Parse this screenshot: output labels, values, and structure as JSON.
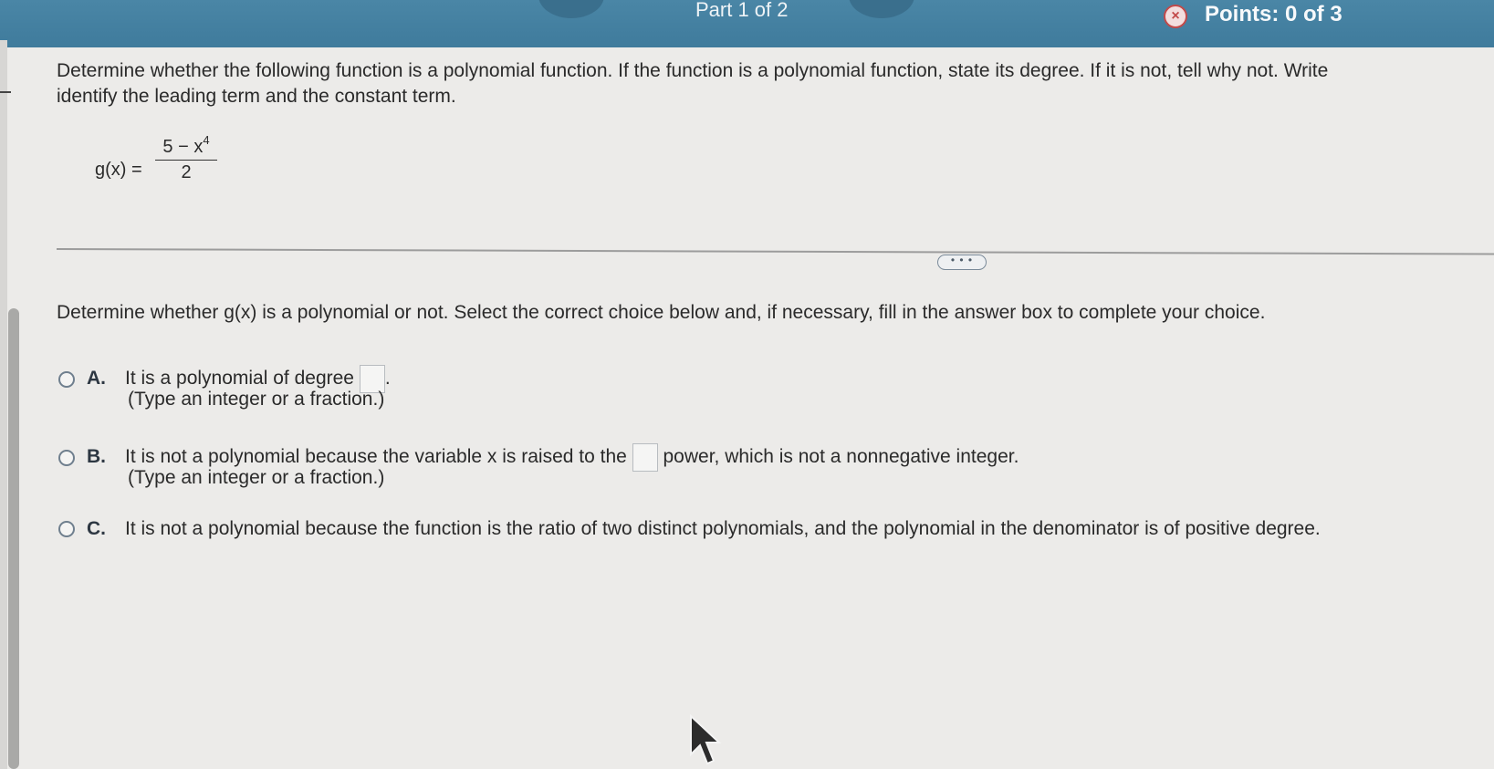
{
  "header": {
    "part_label": "Part 1 of 2",
    "points_label": "Points: 0 of 3",
    "status_icon_glyph": "×",
    "colors": {
      "bar": "#4481a1",
      "error": "#c24a4a"
    }
  },
  "question": {
    "prompt_line1": "Determine whether the following function is a polynomial function. If the function is a polynomial function, state its degree. If it is not, tell why not. Write",
    "prompt_line2": "identify the leading term and the constant term.",
    "function_lhs": "g(x) =",
    "function_numerator": "5 − x",
    "function_exponent": "4",
    "function_denominator": "2"
  },
  "more_button_label": "• • •",
  "part1": {
    "instruction": "Determine whether g(x) is a polynomial or not. Select the correct choice below and, if necessary, fill in the answer box to complete your choice.",
    "choices": [
      {
        "letter": "A.",
        "text_before": "It is a polynomial of degree",
        "text_after": ".",
        "hint": "(Type an integer or a fraction.)"
      },
      {
        "letter": "B.",
        "text_before": "It is not a polynomial because the variable x is raised to the",
        "text_after": "power, which is not a nonnegative integer.",
        "hint": "(Type an integer or a fraction.)"
      },
      {
        "letter": "C.",
        "text_before": "It is not a polynomial because the function is the ratio of two distinct polynomials, and the polynomial in the denominator is of positive degree."
      }
    ]
  }
}
